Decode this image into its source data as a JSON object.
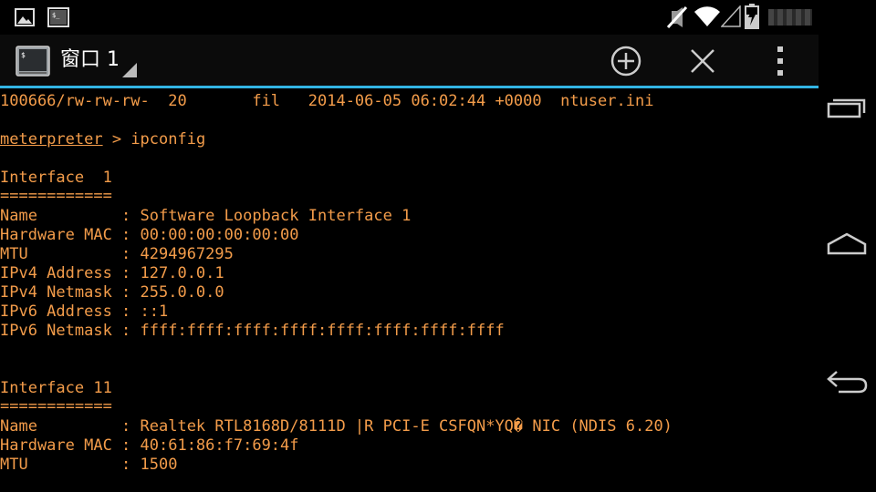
{
  "app": {
    "window_title": "窗口 1"
  },
  "status_bar": {
    "clock": "",
    "icons": [
      "gallery-icon",
      "terminal-notification-icon",
      "mute-icon",
      "wifi-icon",
      "signal-icon",
      "battery-charging-icon"
    ]
  },
  "action_bar": {
    "buttons": [
      "add-window-icon",
      "close-window-icon",
      "overflow-menu-icon"
    ]
  },
  "terminal": {
    "color": "#f39c4a",
    "lines": [
      "100666/rw-rw-rw-  20       fil   2014-06-05 06:02:44 +0000  ntuser.ini",
      "",
      "",
      "",
      "Interface  1",
      "============",
      "Name         : Software Loopback Interface 1",
      "Hardware MAC : 00:00:00:00:00:00",
      "MTU          : 4294967295",
      "IPv4 Address : 127.0.0.1",
      "IPv4 Netmask : 255.0.0.0",
      "IPv6 Address : ::1",
      "IPv6 Netmask : ffff:ffff:ffff:ffff:ffff:ffff:ffff:ffff",
      "",
      "",
      "Interface 11",
      "============",
      "Name         : Realtek RTL8168D/8111D |R PCI-E CSFQN*YQ� NIC (NDIS 6.20)",
      "Hardware MAC : 40:61:86:f7:69:4f",
      "MTU          : 1500"
    ],
    "prompt": {
      "name": "meterpreter",
      "separator": " > ",
      "command": "ipconfig"
    }
  },
  "nav_bar": {
    "buttons": [
      "recent-apps-icon",
      "home-icon",
      "back-icon"
    ]
  }
}
